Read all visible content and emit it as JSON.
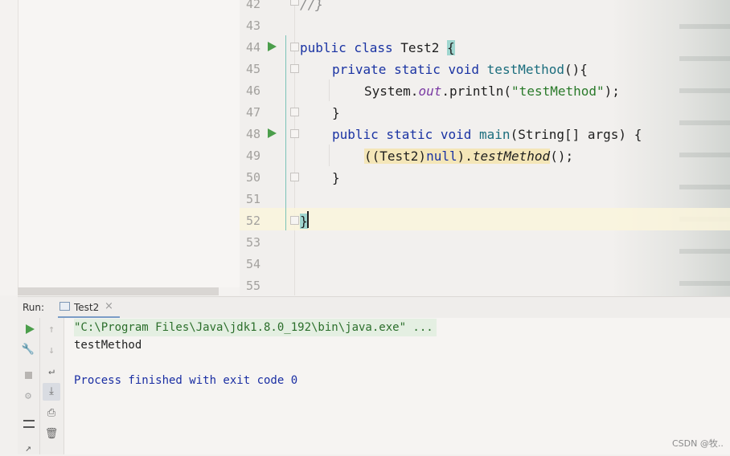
{
  "editor": {
    "lines": [
      {
        "num": "42"
      },
      {
        "num": "43"
      },
      {
        "num": "44"
      },
      {
        "num": "45"
      },
      {
        "num": "46"
      },
      {
        "num": "47"
      },
      {
        "num": "48"
      },
      {
        "num": "49"
      },
      {
        "num": "50"
      },
      {
        "num": "51"
      },
      {
        "num": "52"
      },
      {
        "num": "53"
      },
      {
        "num": "54"
      },
      {
        "num": "55"
      }
    ],
    "code": {
      "l42": "//}",
      "l44_kw": "public class",
      "l44_name": " Test2 ",
      "l44_brace": "{",
      "l45_kw": "private static void",
      "l45_fn": "testMethod",
      "l45_rest": "(){",
      "l46_a": "System.",
      "l46_field": "out",
      "l46_b": ".println(",
      "l46_str": "\"testMethod\"",
      "l46_c": ");",
      "l47": "}",
      "l48_kw": "public static void",
      "l48_fn": "main",
      "l48_rest": "(String[] args) {",
      "l49_a": "((Test2)",
      "l49_null": "null",
      "l49_b": ").",
      "l49_call": "testMethod",
      "l49_c": "();",
      "l50": "}",
      "l52": "}"
    }
  },
  "run_panel": {
    "label": "Run:",
    "tab": {
      "label": "Test2",
      "close": "×"
    },
    "console": {
      "command": "\"C:\\Program Files\\Java\\jdk1.8.0_192\\bin\\java.exe\" ...",
      "output": "testMethod",
      "process": "Process finished with exit code 0"
    }
  },
  "watermark": "CSDN @牧..",
  "colors": {
    "keyword": "#1a33a3",
    "string": "#2a7a2a",
    "run_green": "#4b9e4b"
  }
}
